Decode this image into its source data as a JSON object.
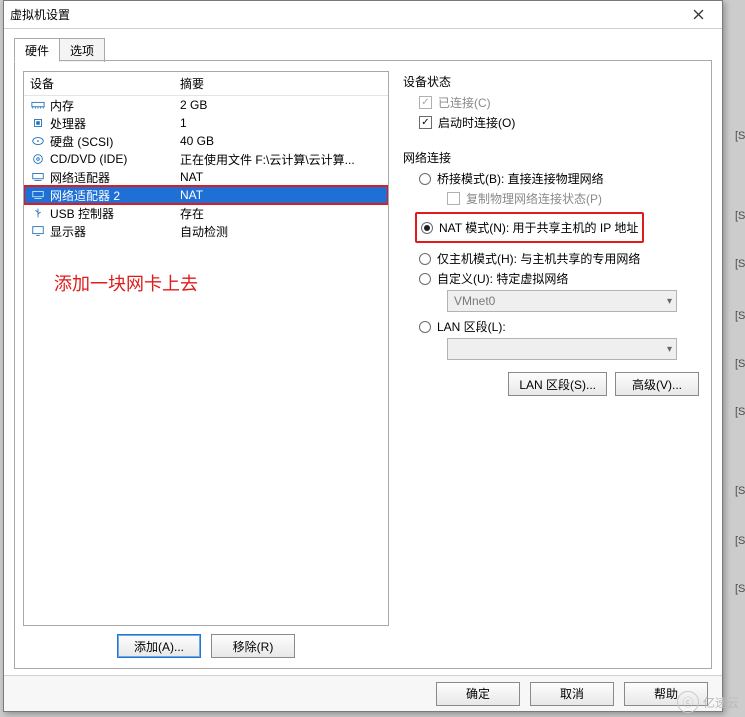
{
  "window": {
    "title": "虚拟机设置"
  },
  "tabs": {
    "hardware": "硬件",
    "options": "选项"
  },
  "columns": {
    "device": "设备",
    "summary": "摘要"
  },
  "devices": [
    {
      "name": "内存",
      "summary": "2 GB"
    },
    {
      "name": "处理器",
      "summary": "1"
    },
    {
      "name": "硬盘 (SCSI)",
      "summary": "40 GB"
    },
    {
      "name": "CD/DVD (IDE)",
      "summary": "正在使用文件 F:\\云计算\\云计算..."
    },
    {
      "name": "网络适配器",
      "summary": "NAT"
    },
    {
      "name": "网络适配器 2",
      "summary": "NAT"
    },
    {
      "name": "USB 控制器",
      "summary": "存在"
    },
    {
      "name": "显示器",
      "summary": "自动检测"
    }
  ],
  "annotation": "添加一块网卡上去",
  "buttons": {
    "add": "添加(A)...",
    "remove": "移除(R)",
    "lan": "LAN 区段(S)...",
    "advanced": "高级(V)...",
    "ok": "确定",
    "cancel": "取消",
    "help": "帮助"
  },
  "status": {
    "group": "设备状态",
    "connected": "已连接(C)",
    "connect_at_power_on": "启动时连接(O)"
  },
  "net": {
    "group": "网络连接",
    "bridged": "桥接模式(B): 直接连接物理网络",
    "replicate": "复制物理网络连接状态(P)",
    "nat": "NAT 模式(N): 用于共享主机的 IP 地址",
    "hostonly": "仅主机模式(H): 与主机共享的专用网络",
    "custom": "自定义(U): 特定虚拟网络",
    "custom_value": "VMnet0",
    "lanseg": "LAN 区段(L):",
    "lanseg_value": ""
  },
  "watermark": "亿速云"
}
